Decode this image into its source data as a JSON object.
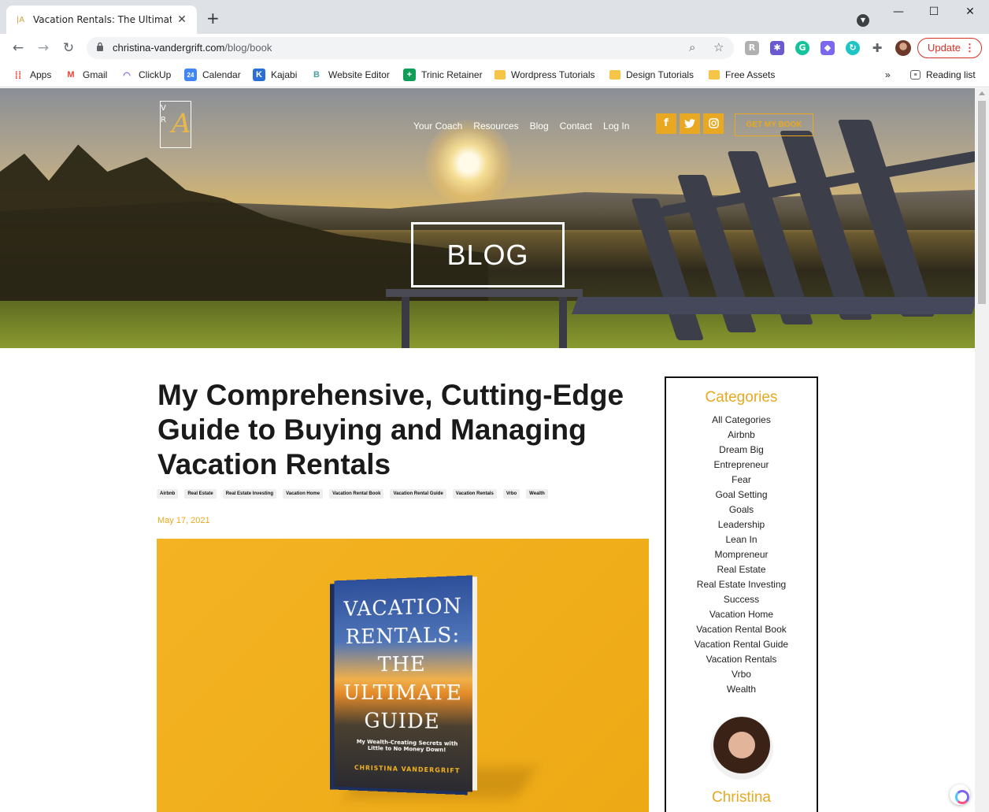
{
  "browser": {
    "tab_title": "Vacation Rentals: The Ultimate Gu",
    "url_host": "christina-vandergrift.com",
    "url_path": "/blog/book",
    "update_label": "Update",
    "bookmarks": [
      "Apps",
      "Gmail",
      "ClickUp",
      "Calendar",
      "Kajabi",
      "Website Editor",
      "Trinic Retainer",
      "Wordpress Tutorials",
      "Design Tutorials",
      "Free Assets"
    ],
    "reading_list": "Reading list"
  },
  "site": {
    "logo_v": "V",
    "logo_r": "R",
    "logo_a": "A",
    "nav": [
      "Your Coach",
      "Resources",
      "Blog",
      "Contact",
      "Log In"
    ],
    "cta": "GET MY BOOK",
    "hero_title": "BLOG"
  },
  "post": {
    "title": "My Comprehensive, Cutting-Edge Guide to Buying and Managing Vacation Rentals",
    "tags": [
      "Airbnb",
      "Real Estate",
      "Real Estate Investing",
      "Vacation Home",
      "Vacation Rental Book",
      "Vacation Rental Guide",
      "Vacation Rentals",
      "Vrbo",
      "Wealth"
    ],
    "date": "May 17, 2021",
    "book": {
      "line1": "VACATION",
      "line2": "RENTALS:",
      "line3": "THE",
      "line4": "ULTIMATE",
      "line5": "GUIDE",
      "subtitle": "My Wealth-Creating Secrets with Little to No Money Down!",
      "author": "CHRISTINA VANDERGRIFT"
    }
  },
  "sidebar": {
    "heading": "Categories",
    "categories": [
      "All Categories",
      "Airbnb",
      "Dream Big",
      "Entrepreneur",
      "Fear",
      "Goal Setting",
      "Goals",
      "Leadership",
      "Lean In",
      "Mompreneur",
      "Real Estate",
      "Real Estate Investing",
      "Success",
      "Vacation Home",
      "Vacation Rental Book",
      "Vacation Rental Guide",
      "Vacation Rentals",
      "Vrbo",
      "Wealth"
    ],
    "author_name": "Christina"
  },
  "colors": {
    "accent": "#e8a821",
    "chrome_bg": "#dee1e6"
  }
}
